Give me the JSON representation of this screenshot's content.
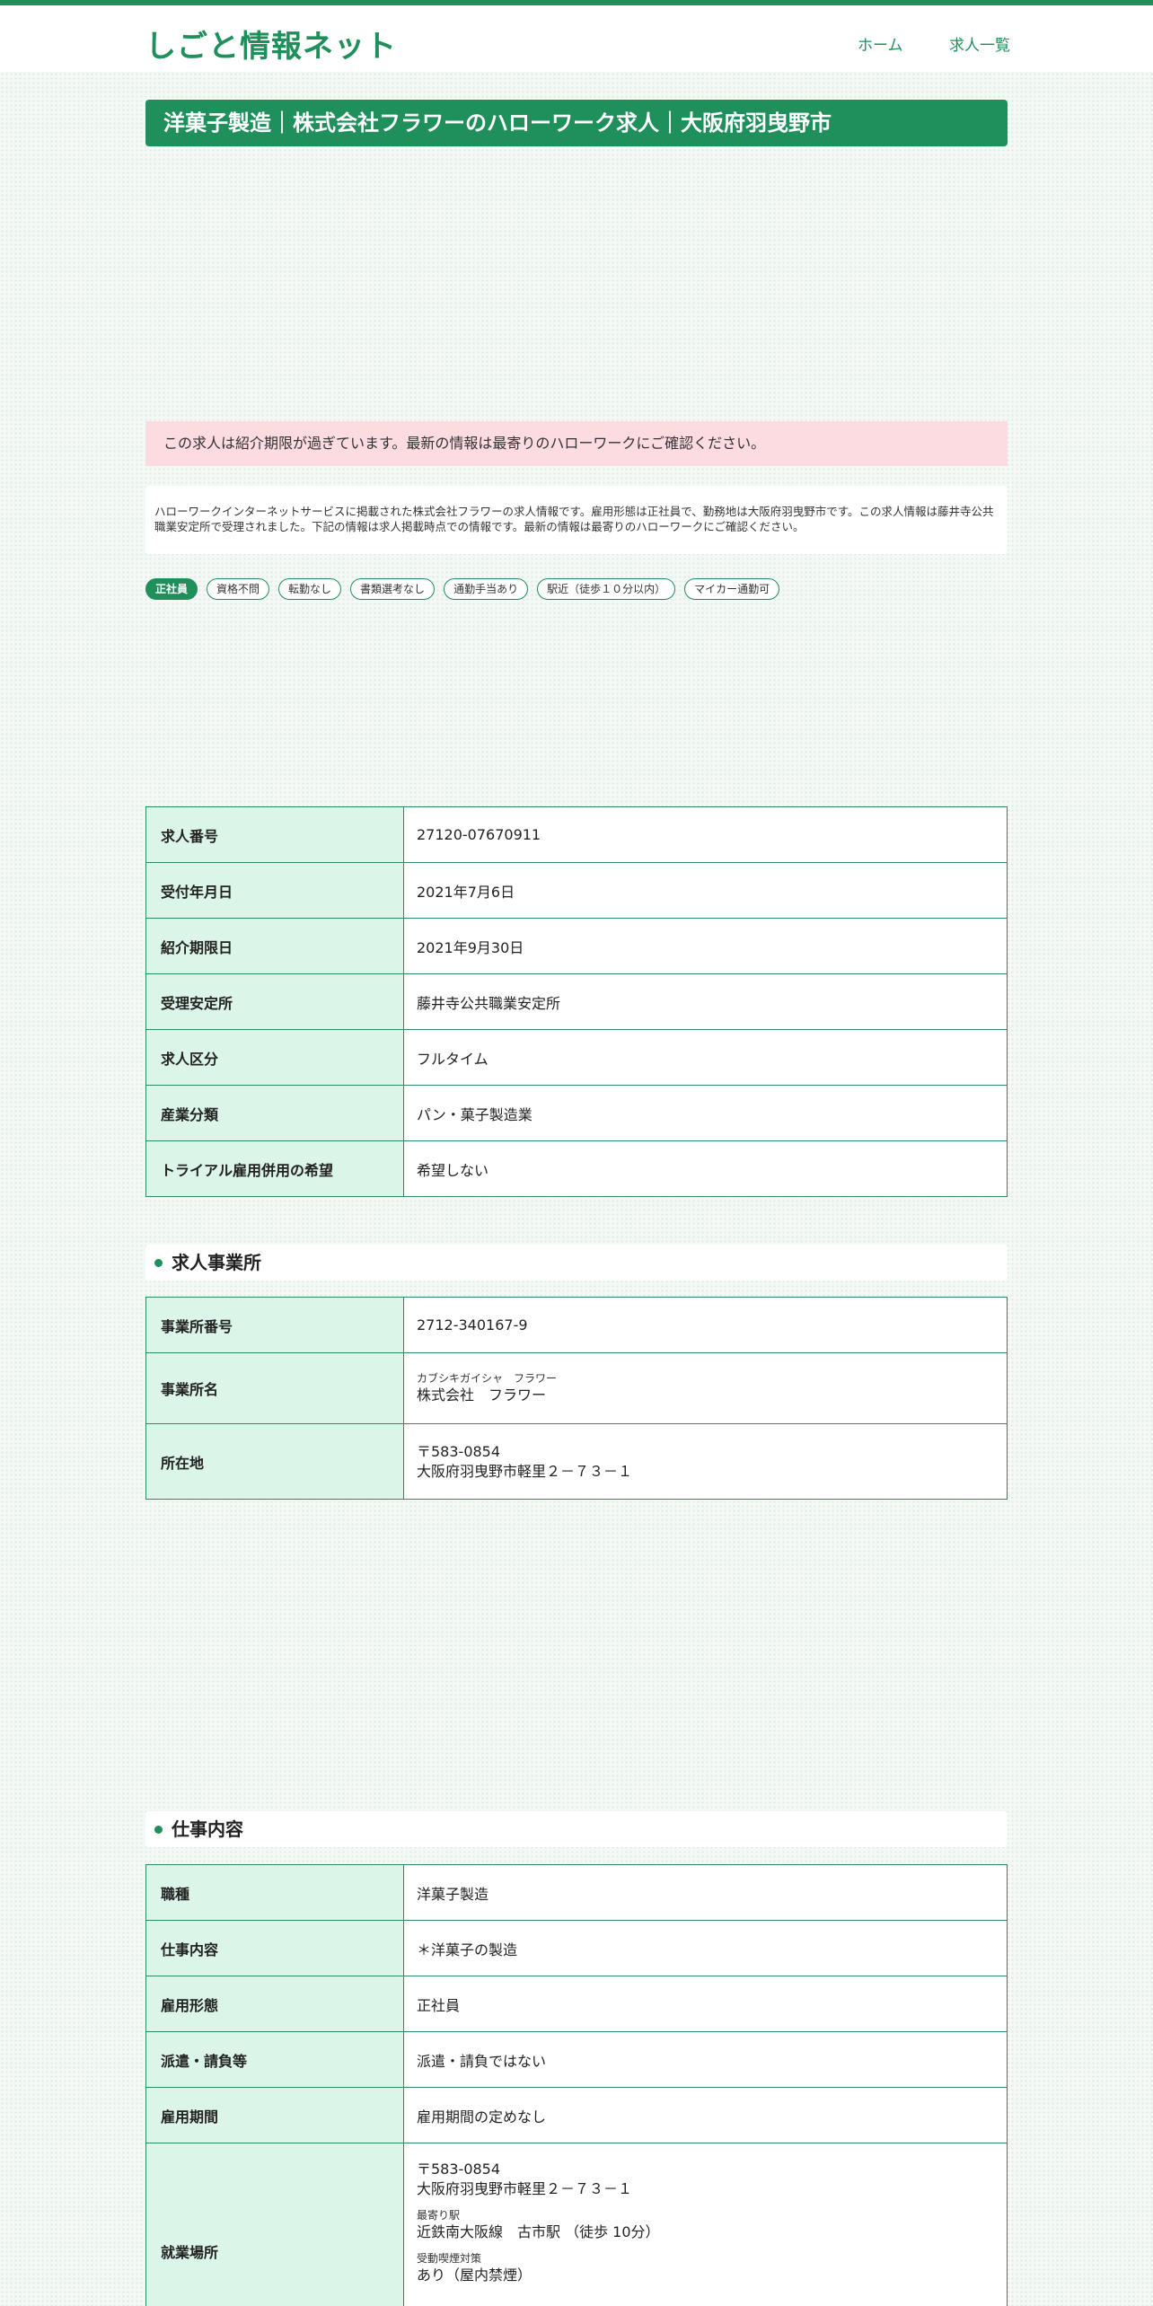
{
  "header": {
    "logo": "しごと情報ネット",
    "nav": {
      "home": "ホーム",
      "list": "求人一覧"
    }
  },
  "title": "洋菓子製造｜株式会社フラワーのハローワーク求人｜大阪府羽曳野市",
  "notice": {
    "expired": "この求人は紹介期限が過ぎています。最新の情報は最寄りのハローワークにご確認ください。",
    "intro": "ハローワークインターネットサービスに掲載された株式会社フラワーの求人情報です。雇用形態は正社員で、勤務地は大阪府羽曳野市です。この求人情報は藤井寺公共職業安定所で受理されました。下記の情報は求人掲載時点での情報です。最新の情報は最寄りのハローワークにご確認ください。"
  },
  "tags": [
    "正社員",
    "資格不問",
    "転勤なし",
    "書類選考なし",
    "通勤手当あり",
    "駅近（徒歩１０分以内）",
    "マイカー通勤可"
  ],
  "basic": [
    {
      "label": "求人番号",
      "value": "27120-07670911"
    },
    {
      "label": "受付年月日",
      "value": "2021年7月6日"
    },
    {
      "label": "紹介期限日",
      "value": "2021年9月30日"
    },
    {
      "label": "受理安定所",
      "value": "藤井寺公共職業安定所"
    },
    {
      "label": "求人区分",
      "value": "フルタイム"
    },
    {
      "label": "産業分類",
      "value": "パン・菓子製造業"
    },
    {
      "label": "トライアル雇用併用の希望",
      "value": "希望しない"
    }
  ],
  "office": {
    "heading": "求人事業所",
    "number_label": "事業所番号",
    "number": "2712-340167-9",
    "name_label": "事業所名",
    "name_kana": "カブシキガイシャ　フラワー",
    "name": "株式会社　フラワー",
    "address_label": "所在地",
    "postal": "〒583-0854",
    "address": "大阪府羽曳野市軽里２－７３－１"
  },
  "job": {
    "heading": "仕事内容",
    "rows": [
      {
        "label": "職種",
        "value": "洋菓子製造"
      },
      {
        "label": "仕事内容",
        "value": "＊洋菓子の製造"
      },
      {
        "label": "雇用形態",
        "value": "正社員"
      },
      {
        "label": "派遣・請負等",
        "value": "派遣・請負ではない"
      },
      {
        "label": "雇用期間",
        "value": "雇用期間の定めなし"
      }
    ],
    "workplace": {
      "label": "就業場所",
      "postal": "〒583-0854",
      "address": "大阪府羽曳野市軽里２－７３－１",
      "station_label": "最寄り駅",
      "station": "近鉄南大阪線　古市駅 （徒歩 10分）",
      "smoking_label": "受動喫煙対策",
      "smoking": "あり（屋内禁煙）"
    }
  }
}
